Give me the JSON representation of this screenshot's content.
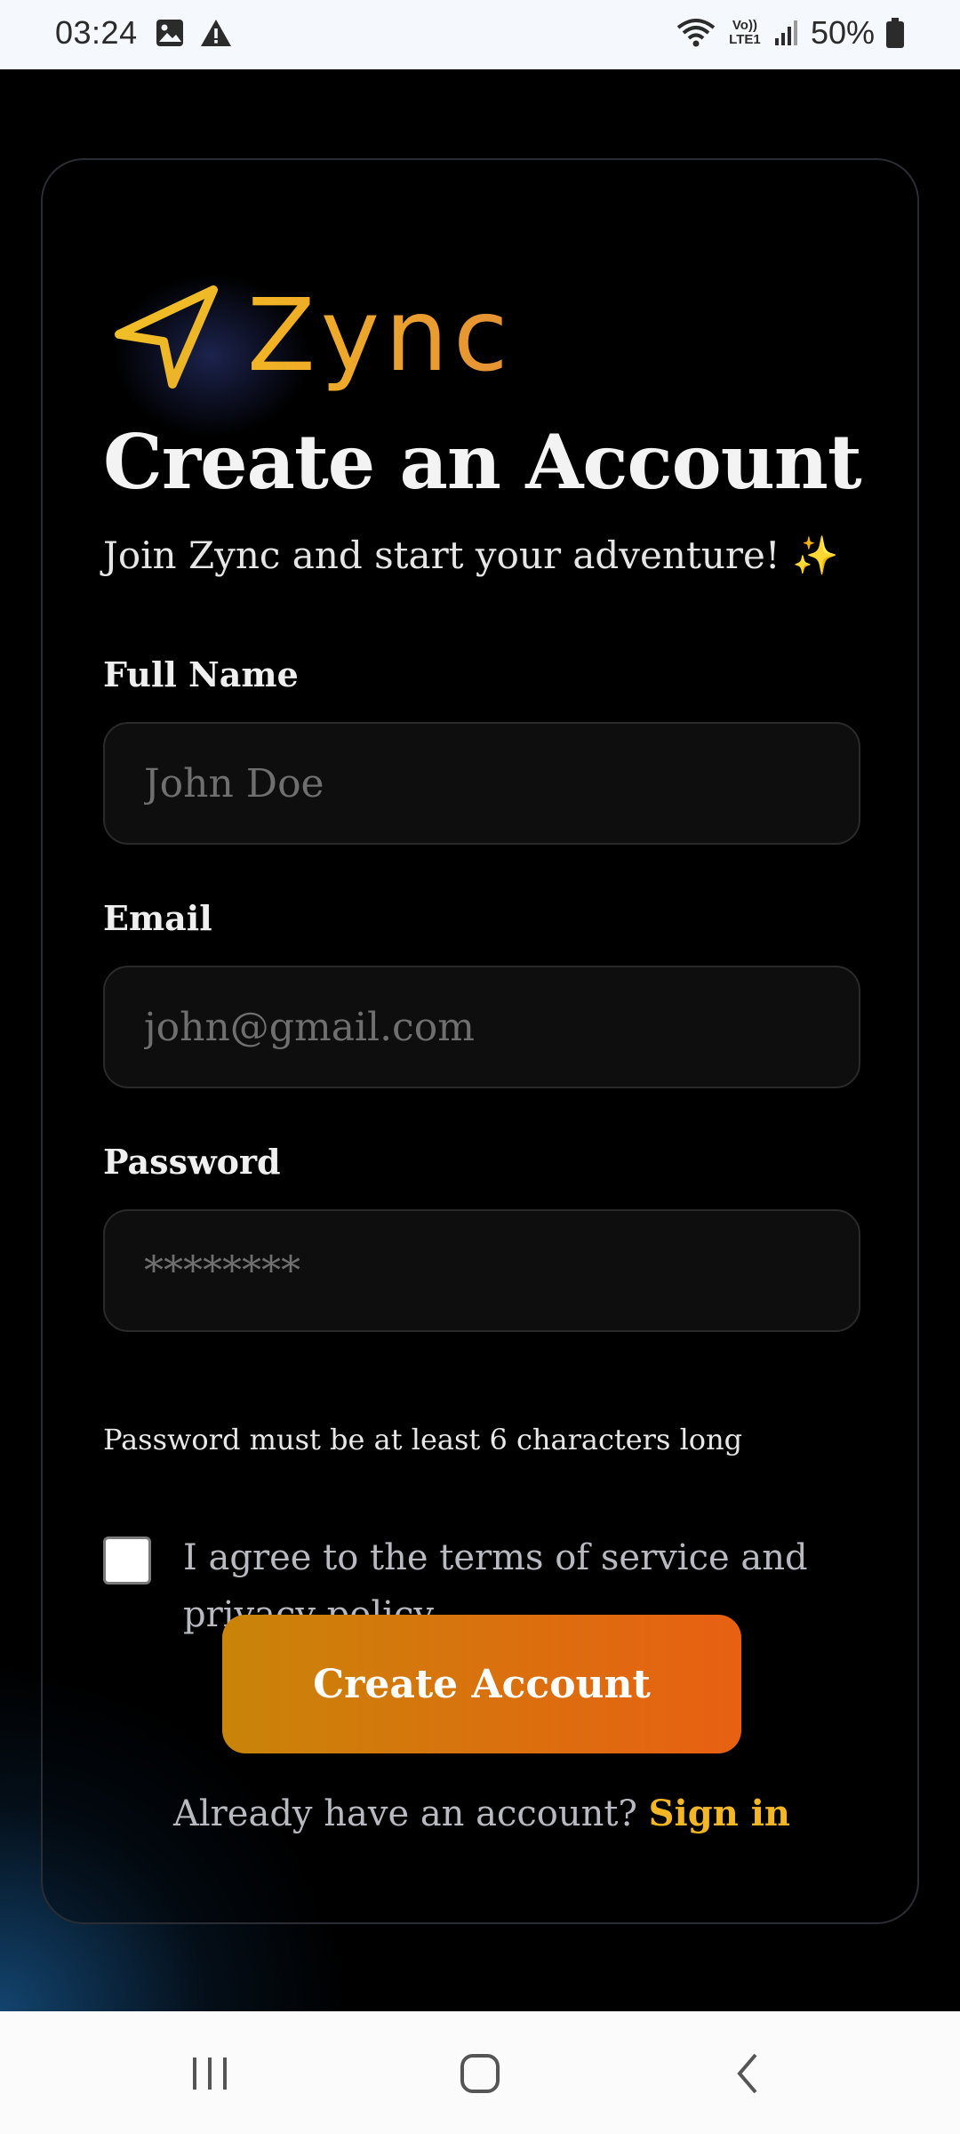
{
  "status_bar": {
    "time": "03:24",
    "left_icons": [
      "image-icon",
      "warning-icon"
    ],
    "right_icons": [
      "wifi-icon",
      "volte-icon",
      "signal-icon",
      "battery-icon"
    ],
    "volte_label": "Vo)) LTE1",
    "battery": "50%"
  },
  "app": {
    "logo_text": "Zync",
    "logo_icon": "navigation-arrow-icon",
    "title": "Create an Account",
    "subtitle": "Join Zync and start your adventure! ✨",
    "fields": {
      "full_name": {
        "label": "Full Name",
        "placeholder": "John Doe",
        "value": ""
      },
      "email": {
        "label": "Email",
        "placeholder": "john@gmail.com",
        "value": ""
      },
      "password": {
        "label": "Password",
        "placeholder": "********",
        "value": ""
      }
    },
    "password_helper": "Password must be at least 6 characters long",
    "terms_label": "I agree to the terms of service and privacy policy",
    "terms_checked": false,
    "create_button": "Create Account",
    "signin_prompt": "Already have an account?",
    "signin_link": "Sign in"
  },
  "nav_bar": {
    "buttons": [
      "recent-apps-icon",
      "home-icon",
      "back-icon"
    ]
  },
  "colors": {
    "accent": "#f3b725",
    "button_gradient_start": "#c98409",
    "button_gradient_end": "#e86012",
    "background": "#000000"
  }
}
